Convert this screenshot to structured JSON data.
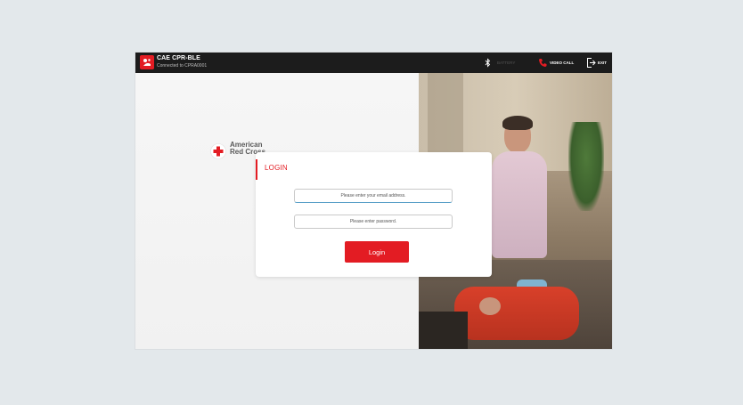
{
  "header": {
    "app_title": "CAE CPR-BLE",
    "connection_status": "Connected to CPRA0001",
    "bluetooth_status": "BATTERY",
    "video_call_label": "VIDEO CALL",
    "exit_label": "EXIT"
  },
  "brand": {
    "line1": "American",
    "line2": "Red Cross"
  },
  "login": {
    "title": "LOGIN",
    "email_placeholder": "Please enter your email address.",
    "password_placeholder": "Please enter password.",
    "button_label": "Login"
  },
  "colors": {
    "accent": "#e31c23",
    "topbar": "#1c1c1c",
    "page_background": "#e3e8eb"
  },
  "icons": [
    "app-logo-icon",
    "bluetooth-icon",
    "video-call-icon",
    "exit-icon",
    "red-cross-icon"
  ]
}
